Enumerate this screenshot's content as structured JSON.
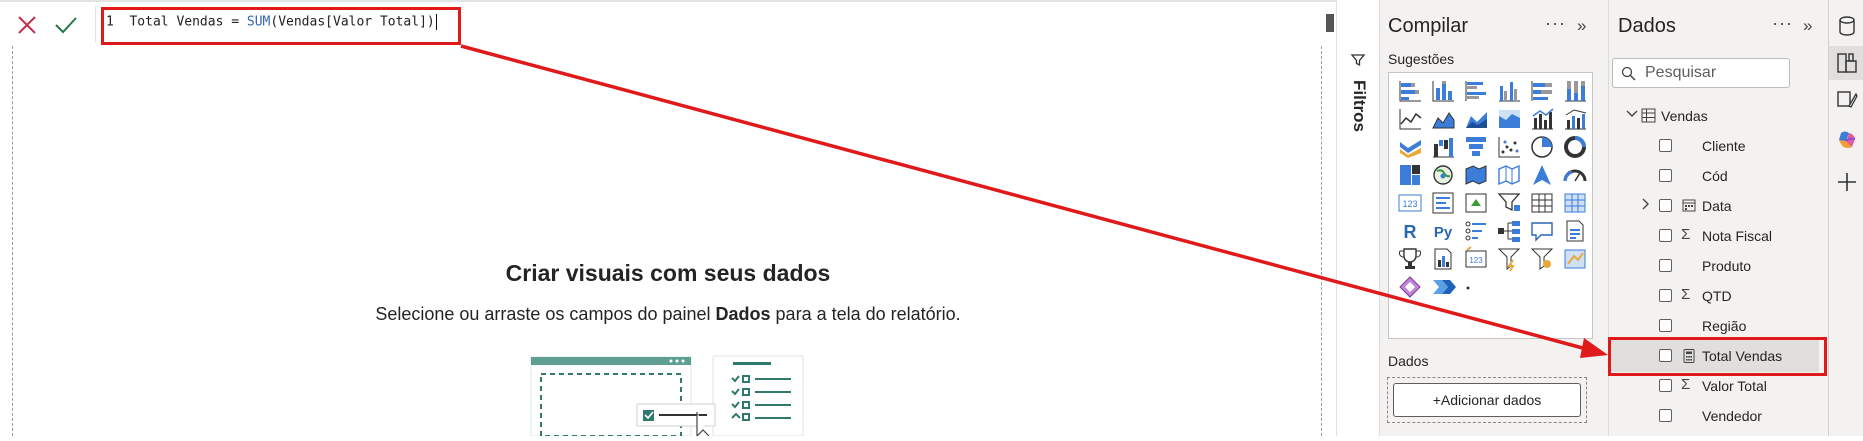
{
  "formula_bar": {
    "line_number": "1",
    "measure_name": "Total Vendas",
    "operator": "=",
    "function": "SUM",
    "open_paren": "(",
    "argument": "Vendas[Valor Total]",
    "close_paren": ")"
  },
  "canvas": {
    "empty_title": "Criar visuais com seus dados",
    "empty_desc_before": "Selecione ou arraste os campos do painel ",
    "empty_desc_bold": "Dados",
    "empty_desc_after": " para a tela do relatório."
  },
  "filters": {
    "label": "Filtros"
  },
  "build_pane": {
    "title": "Compilar",
    "more": "···",
    "collapse": "»",
    "suggestions_label": "Sugestões",
    "data_label": "Dados",
    "add_data_button": "+Adicionar dados"
  },
  "data_pane": {
    "title": "Dados",
    "more": "···",
    "collapse": "»",
    "search_placeholder": "Pesquisar",
    "table_name": "Vendas",
    "fields": [
      {
        "label": "Cliente",
        "icon": "none"
      },
      {
        "label": "Cód",
        "icon": "none"
      },
      {
        "label": "Data",
        "icon": "calendar-icon"
      },
      {
        "label": "Nota Fiscal",
        "icon": "sigma-icon"
      },
      {
        "label": "Produto",
        "icon": "none"
      },
      {
        "label": "QTD",
        "icon": "sigma-icon"
      },
      {
        "label": "Região",
        "icon": "none"
      },
      {
        "label": "Total Vendas",
        "icon": "calculator-icon"
      },
      {
        "label": "Valor Total",
        "icon": "sigma-icon"
      },
      {
        "label": "Vendedor",
        "icon": "none"
      }
    ]
  },
  "colors": {
    "highlight_red": "#e0191b",
    "pane_bg": "#f3f2f1",
    "accent_blue": "#3067b0",
    "cancel_red": "#c4314b",
    "commit_green": "#237b4b"
  }
}
